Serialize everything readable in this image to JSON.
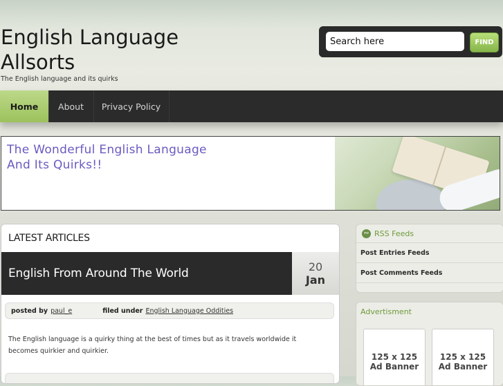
{
  "site": {
    "title": "English Language Allsorts",
    "tagline": "The English language and its quirks"
  },
  "search": {
    "placeholder": "Search here",
    "button_label": "FIND"
  },
  "nav": {
    "items": [
      {
        "label": "Home",
        "active": true
      },
      {
        "label": "About",
        "active": false
      },
      {
        "label": "Privacy Policy",
        "active": false
      }
    ]
  },
  "banner": {
    "line1": "The Wonderful English Language",
    "line2": "And Its Quirks!!"
  },
  "main": {
    "heading": "LATEST ARTICLES",
    "post": {
      "title": "English From Around The World",
      "date_day": "20",
      "date_month": "Jan",
      "posted_by_label": "posted by",
      "author": "paul_e",
      "filed_under_label": "filed under",
      "category": "English Language Oddities",
      "excerpt": "The English language is a quirky thing at the best of times but as it travels worldwide it becomes quirkier and quirkier."
    }
  },
  "sidebar": {
    "rss": {
      "title": "RSS Feeds",
      "items": [
        "Post Entries Feeds",
        "Post Comments Feeds"
      ]
    },
    "ads": {
      "title": "Advertisment",
      "banners": [
        {
          "size": "125 x 125",
          "label": "Ad Banner"
        },
        {
          "size": "125 x 125",
          "label": "Ad Banner"
        }
      ]
    }
  },
  "colors": {
    "accent_green": "#9cc25c",
    "nav_dark": "#2b2b2b",
    "banner_text": "#6a5ac0"
  }
}
